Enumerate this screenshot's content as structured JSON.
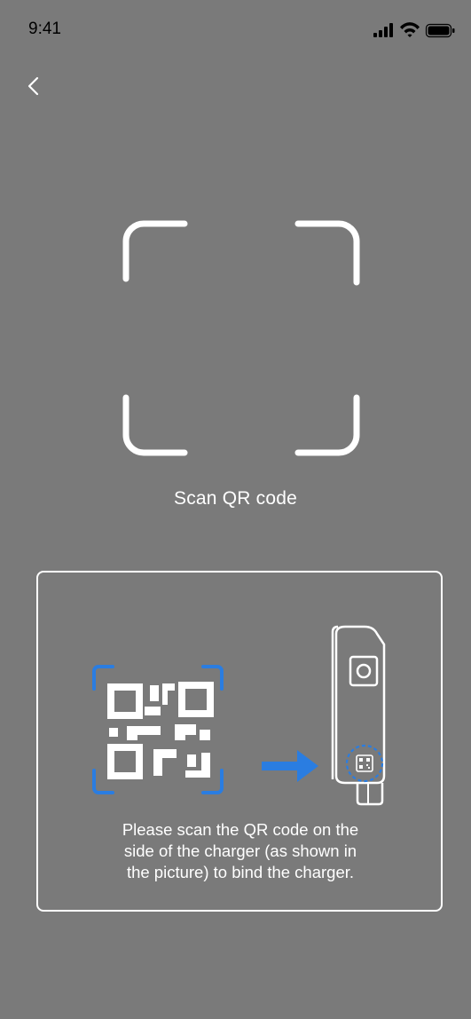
{
  "status_bar": {
    "time": "9:41"
  },
  "header": {
    "back_icon": "chevron-left-icon"
  },
  "scanner": {
    "frame_icon": "scan-frame-icon",
    "label": "Scan QR code"
  },
  "info_card": {
    "qr_icon": "qr-code-icon",
    "arrow_icon": "arrow-right-icon",
    "charger_icon": "charger-icon",
    "text": "Please scan the QR code on the\nside of the charger (as shown in\nthe picture) to bind the charger."
  },
  "colors": {
    "background": "#7a7a7a",
    "foreground": "#ffffff",
    "accent": "#2a7de1"
  }
}
